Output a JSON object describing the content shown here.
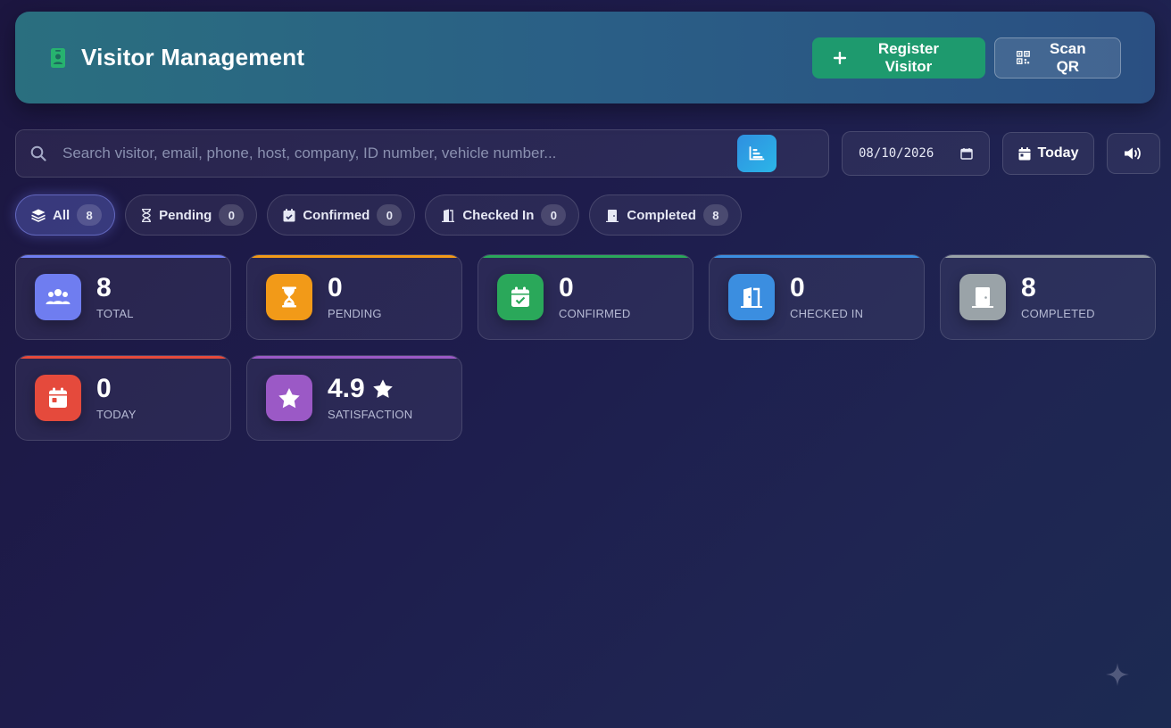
{
  "header": {
    "title": "Visitor Management",
    "register_label": "Register Visitor",
    "scan_label": "Scan QR"
  },
  "search": {
    "placeholder": "Search visitor, email, phone, host, company, ID number, vehicle number...",
    "value": ""
  },
  "date": {
    "value": "08/10/2026"
  },
  "today_label": "Today",
  "filters": [
    {
      "label": "All",
      "count": "8",
      "active": true
    },
    {
      "label": "Pending",
      "count": "0"
    },
    {
      "label": "Confirmed",
      "count": "0"
    },
    {
      "label": "Checked In",
      "count": "0"
    },
    {
      "label": "Completed",
      "count": "8"
    }
  ],
  "stats": [
    {
      "value": "8",
      "label": "TOTAL",
      "color": "#6f7df0",
      "icon": "users-icon"
    },
    {
      "value": "0",
      "label": "PENDING",
      "color": "#f29a18",
      "icon": "hourglass-icon"
    },
    {
      "value": "0",
      "label": "CONFIRMED",
      "color": "#2aa85a",
      "icon": "calendar-check-icon"
    },
    {
      "value": "0",
      "label": "CHECKED IN",
      "color": "#3b8ee0",
      "icon": "door-open-icon"
    },
    {
      "value": "8",
      "label": "COMPLETED",
      "color": "#9aa3a8",
      "icon": "door-closed-icon"
    },
    {
      "value": "0",
      "label": "TODAY",
      "color": "#e54a3c",
      "icon": "calendar-day-icon"
    },
    {
      "value": "4.9",
      "label": "SATISFACTION",
      "color": "#9b59c6",
      "icon": "star-icon"
    }
  ],
  "colors": {
    "primary": "#1e9a6e",
    "accent": "#2f8fe0"
  }
}
